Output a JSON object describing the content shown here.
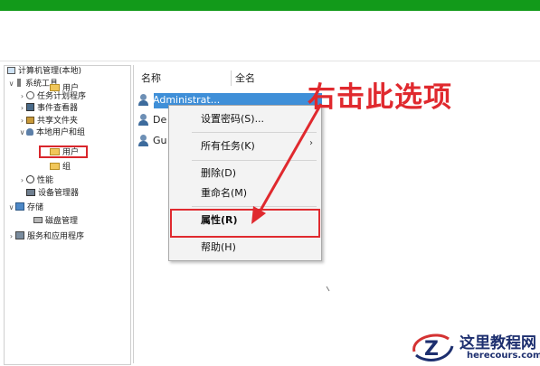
{
  "tree": {
    "items": [
      {
        "label": "计算机管理(本地)",
        "chevron": "",
        "icon": "computer-icon"
      },
      {
        "label": "系统工具",
        "chevron": "∨",
        "icon": "tools-icon"
      },
      {
        "label": "任务计划程序",
        "chevron": "›",
        "icon": "clock-icon"
      },
      {
        "label": "事件查看器",
        "chevron": "›",
        "icon": "event-viewer-icon"
      },
      {
        "label": "共享文件夹",
        "chevron": "›",
        "icon": "shared-folder-icon"
      },
      {
        "label": "本地用户和组",
        "chevron": "∨",
        "icon": "users-group-icon"
      },
      {
        "label": "用户",
        "chevron": "",
        "icon": "folder-icon"
      },
      {
        "label": "组",
        "chevron": "",
        "icon": "folder-icon"
      },
      {
        "label": "性能",
        "chevron": "›",
        "icon": "performance-icon"
      },
      {
        "label": "设备管理器",
        "chevron": "",
        "icon": "device-manager-icon"
      },
      {
        "label": "存储",
        "chevron": "∨",
        "icon": "storage-icon"
      },
      {
        "label": "磁盘管理",
        "chevron": "",
        "icon": "disk-icon"
      },
      {
        "label": "服务和应用程序",
        "chevron": "›",
        "icon": "services-icon"
      }
    ]
  },
  "list": {
    "col_name": "名称",
    "col_fullname": "全名",
    "rows": [
      {
        "name": "Administrat..."
      },
      {
        "name": "De"
      },
      {
        "name": "Gu"
      }
    ]
  },
  "context_menu": {
    "set_password": "设置密码(S)...",
    "all_tasks": "所有任务(K)",
    "all_tasks_arrow": "›",
    "delete": "删除(D)",
    "rename": "重命名(M)",
    "properties": "属性(R)",
    "help": "帮助(H)"
  },
  "annotation": {
    "callout": "右击此选项",
    "color": "#e0292e"
  },
  "watermark": {
    "site_name": "这里教程网",
    "site_url": "herecours.com"
  },
  "colors": {
    "top_bar": "#129a1a",
    "selection": "#3f8fd8",
    "highlight": "#e02a2f"
  }
}
